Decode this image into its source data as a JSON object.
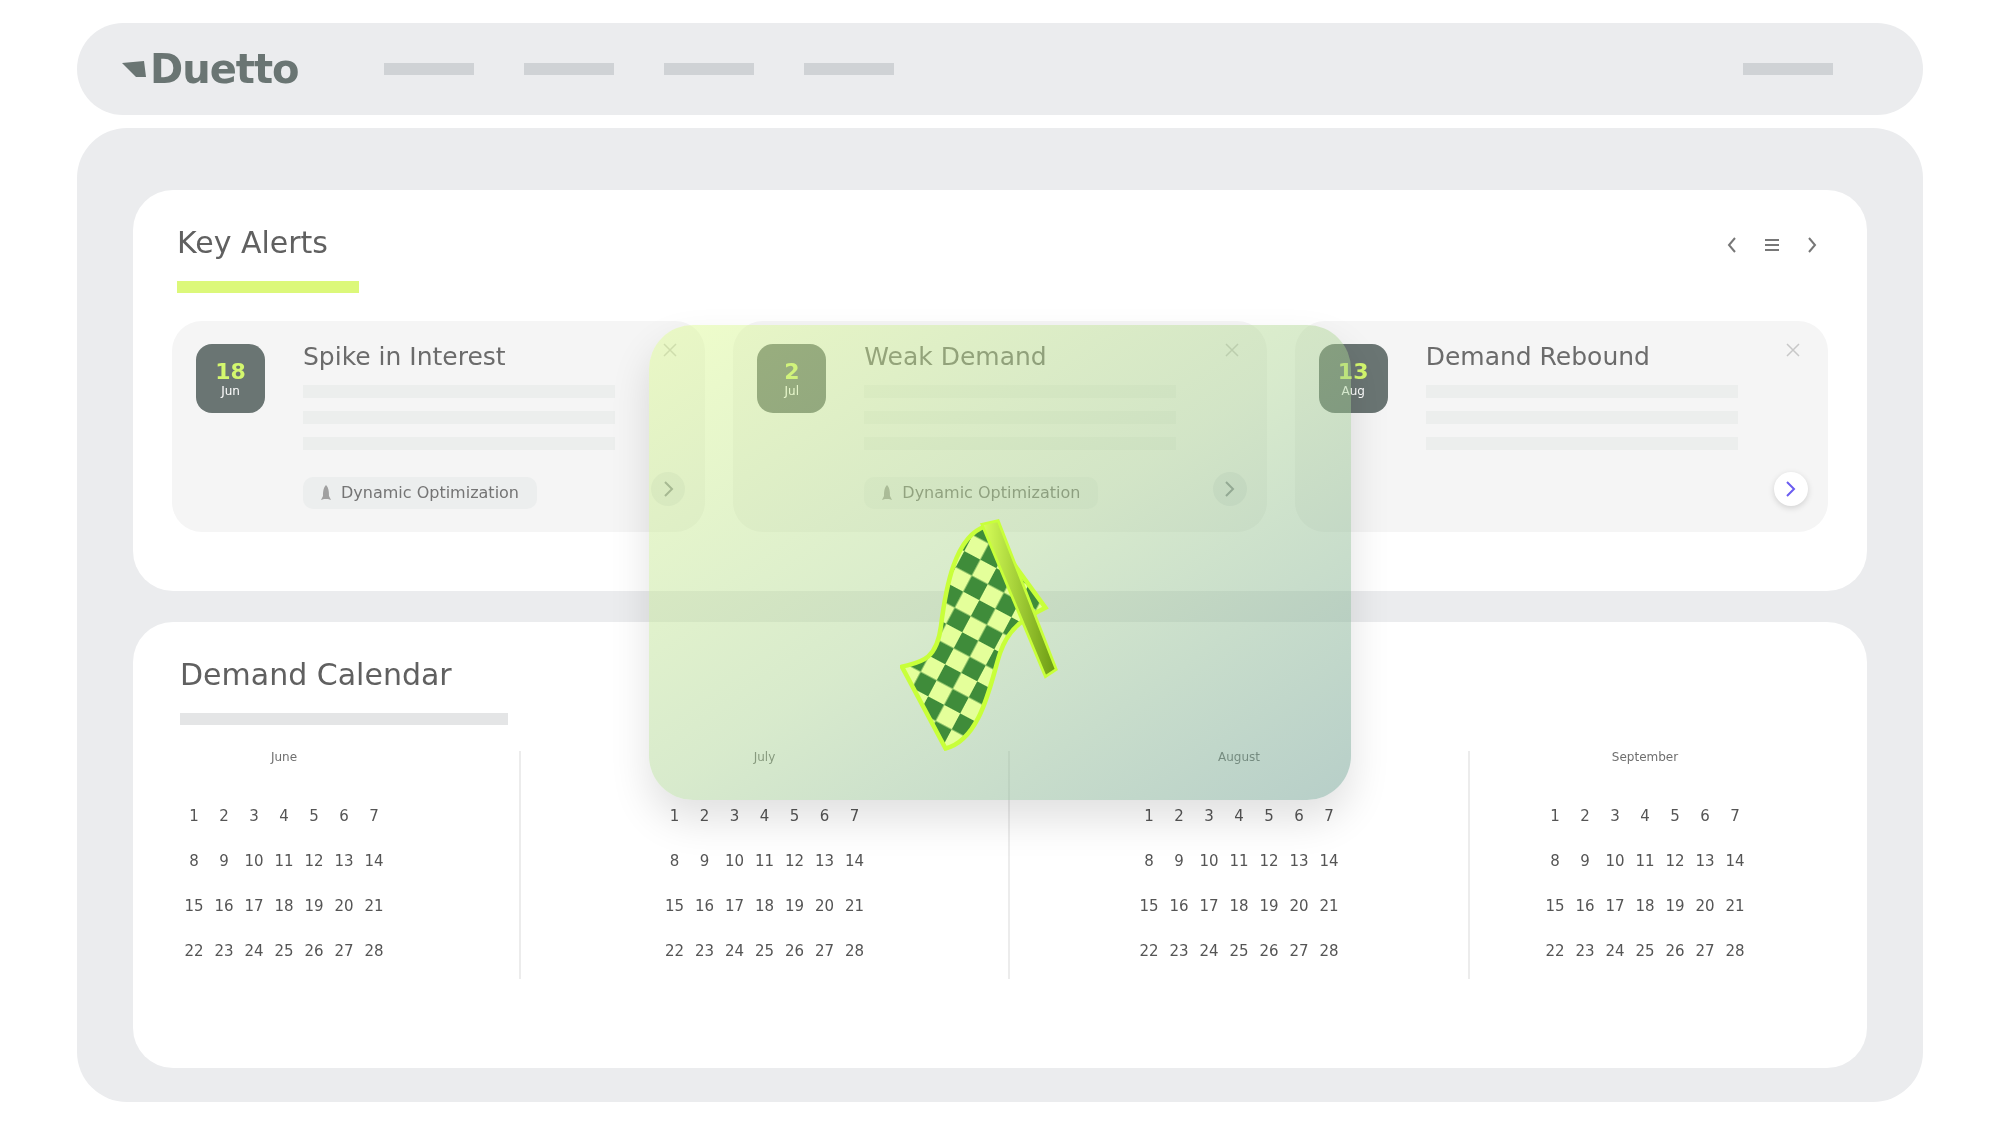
{
  "header": {
    "logo": "Duetto"
  },
  "key_alerts": {
    "title": "Key Alerts",
    "alerts": [
      {
        "day": "18",
        "month": "Jun",
        "title": "Spike in Interest",
        "tag": "Dynamic Optimization",
        "next_button_active": false
      },
      {
        "day": "2",
        "month": "Jul",
        "title": "Weak Demand",
        "tag": "Dynamic Optimization",
        "next_button_active": false
      },
      {
        "day": "13",
        "month": "Aug",
        "title": "Demand Rebound",
        "next_button_active": true
      }
    ]
  },
  "demand_calendar": {
    "title": "Demand Calendar",
    "months": [
      {
        "name": "June",
        "days": [
          "1",
          "2",
          "3",
          "4",
          "5",
          "6",
          "7",
          "8",
          "9",
          "10",
          "11",
          "12",
          "13",
          "14",
          "15",
          "16",
          "17",
          "18",
          "19",
          "20",
          "21",
          "22",
          "23",
          "24",
          "25",
          "26",
          "27",
          "28"
        ]
      },
      {
        "name": "July",
        "days": [
          "1",
          "2",
          "3",
          "4",
          "5",
          "6",
          "7",
          "8",
          "9",
          "10",
          "11",
          "12",
          "13",
          "14",
          "15",
          "16",
          "17",
          "18",
          "19",
          "20",
          "21",
          "22",
          "23",
          "24",
          "25",
          "26",
          "27",
          "28"
        ]
      },
      {
        "name": "August",
        "days": [
          "1",
          "2",
          "3",
          "4",
          "5",
          "6",
          "7",
          "8",
          "9",
          "10",
          "11",
          "12",
          "13",
          "14",
          "15",
          "16",
          "17",
          "18",
          "19",
          "20",
          "21",
          "22",
          "23",
          "24",
          "25",
          "26",
          "27",
          "28"
        ]
      },
      {
        "name": "September",
        "days": [
          "1",
          "2",
          "3",
          "4",
          "5",
          "6",
          "7",
          "8",
          "9",
          "10",
          "11",
          "12",
          "13",
          "14",
          "15",
          "16",
          "17",
          "18",
          "19",
          "20",
          "21",
          "22",
          "23",
          "24",
          "25",
          "26",
          "27",
          "28"
        ]
      }
    ]
  }
}
